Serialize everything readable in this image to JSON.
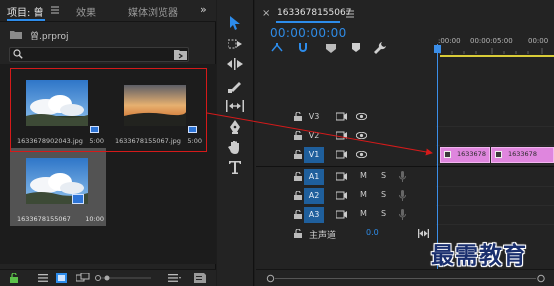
{
  "project_panel": {
    "tabs": [
      {
        "label": "项目: 曾"
      },
      {
        "label": "效果"
      },
      {
        "label": "媒体浏览器"
      }
    ],
    "overflow_label": "»",
    "project_file": "曾.prproj",
    "search": {
      "value": ""
    },
    "items": [
      {
        "name": "1633678902043.jpg",
        "duration": "5:00"
      },
      {
        "name": "1633678155067.jpg",
        "duration": "5:00"
      },
      {
        "name": "1633678155067",
        "duration": "10:00"
      }
    ]
  },
  "timeline": {
    "close_label": "×",
    "sequence_name": "1633678155067",
    "timecode": "00:00:00:00",
    "ruler_labels": [
      ":00:00",
      "00:00:05:00",
      "00:00"
    ],
    "video_tracks": [
      {
        "name": "V3"
      },
      {
        "name": "V2"
      },
      {
        "name": "V1",
        "targeted": true
      }
    ],
    "audio_tracks": [
      {
        "name": "A1",
        "m": "M",
        "s": "S"
      },
      {
        "name": "A2",
        "m": "M",
        "s": "S"
      },
      {
        "name": "A3",
        "m": "M",
        "s": "S"
      }
    ],
    "master": {
      "label": "主声道",
      "value": "0.0"
    },
    "clips": [
      {
        "name": "1633678",
        "color": "#df86de"
      },
      {
        "name": "1633678",
        "color": "#df86de"
      }
    ]
  },
  "tools": [
    "selection-tool",
    "track-select-tool",
    "ripple-edit-tool",
    "razor-tool",
    "slip-tool",
    "pen-tool",
    "hand-tool",
    "type-tool"
  ],
  "colors": {
    "accent": "#2d8ceb",
    "annotation": "#d51a1a",
    "clip": "#df86de",
    "work_area": "#d9cc38"
  },
  "watermark": "最需教育"
}
